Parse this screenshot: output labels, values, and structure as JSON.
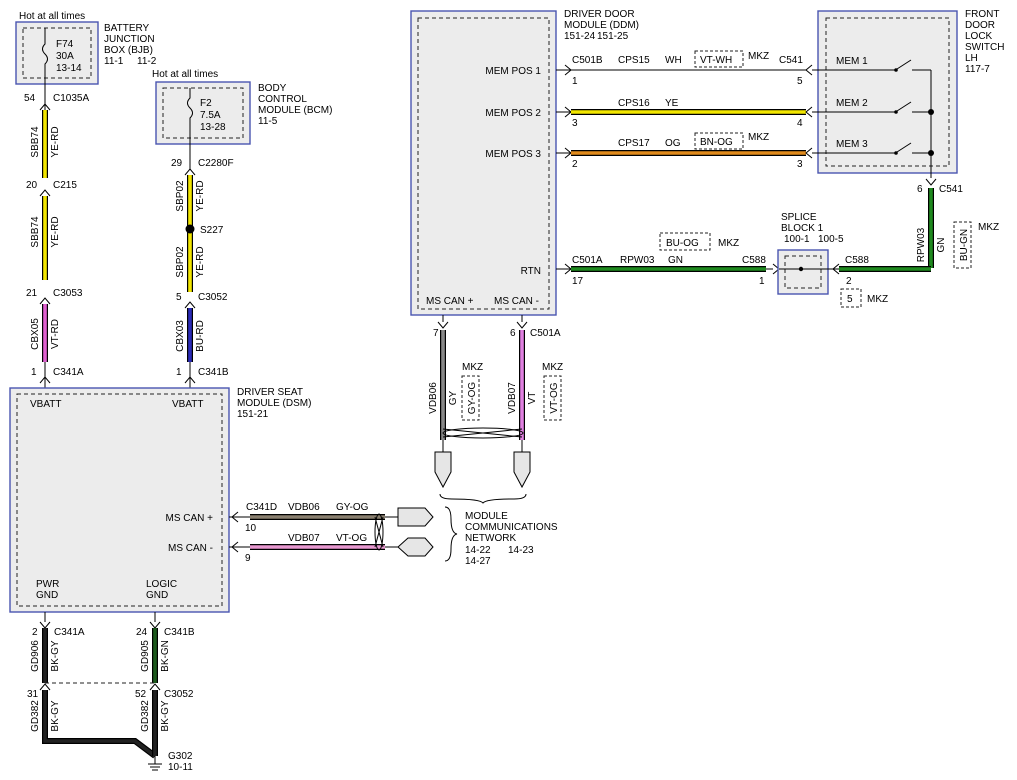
{
  "colors": {
    "module_border": "#4a55b0",
    "module_fill": "#ececec",
    "YE-RD": "#f2e600",
    "VT-RD": "#e060d0",
    "BU-RD": "#2a2ab8",
    "BK-GY": "#222222",
    "BK-GN": "#1d5a1d",
    "GY-OG": "#8a8070",
    "VT-OG": "#e898d0",
    "GY": "#888888",
    "VT": "#e080e0",
    "WH": "#ffffff",
    "YE": "#f2e600",
    "OG": "#e08a1c",
    "GN": "#1f8a1f"
  },
  "bjb": {
    "hot": "Hot at all times",
    "fuse": "F74",
    "amps": "30A",
    "pins": "13-14",
    "title1": "BATTERY",
    "title2": "JUNCTION",
    "title3": "BOX (BJB)",
    "ref_a": "11-1",
    "ref_b": "11-2"
  },
  "bcm": {
    "hot": "Hot at all times",
    "fuse": "F2",
    "amps": "7.5A",
    "pins": "13-28",
    "title1": "BODY",
    "title2": "CONTROL",
    "title3": "MODULE (BCM)",
    "ref": "11-5"
  },
  "wire_left": {
    "pin54": "54",
    "c1035a": "C1035A",
    "circ1": "SBB74",
    "col1": "YE-RD",
    "pin20": "20",
    "c215": "C215",
    "circ2": "SBB74",
    "col2": "YE-RD",
    "pin21": "21",
    "c3053": "C3053",
    "circ3": "CBX05",
    "col3": "VT-RD",
    "pin1": "1",
    "c341a": "C341A"
  },
  "wire_mid": {
    "pin29": "29",
    "c2280f": "C2280F",
    "circ1": "SBP02",
    "col1": "YE-RD",
    "splice": "S227",
    "circ2": "SBP02",
    "col2": "YE-RD",
    "pin5": "5",
    "c3052": "C3052",
    "circ3": "CBX03",
    "col3": "BU-RD",
    "pin1": "1",
    "c341b": "C341B"
  },
  "dsm": {
    "vbatt_a": "VBATT",
    "vbatt_b": "VBATT",
    "title1": "DRIVER SEAT",
    "title2": "MODULE (DSM)",
    "ref": "151-21",
    "mscan_plus": "MS CAN +",
    "mscan_minus": "MS CAN -",
    "pwr1": "PWR",
    "pwr2": "GND",
    "logic1": "LOGIC",
    "logic2": "GND"
  },
  "dsm_can": {
    "conn": "C341D",
    "circ1": "VDB06",
    "col1": "GY-OG",
    "pin1": "10",
    "circ2": "VDB07",
    "col2": "VT-OG",
    "pin2": "9"
  },
  "network": {
    "l1": "MODULE",
    "l2": "COMMUNICATIONS",
    "l3": "NETWORK",
    "r1": "14-22",
    "r2": "14-23",
    "r3": "14-27"
  },
  "grounds": {
    "pin2": "2",
    "c341a": "C341A",
    "circ_a": "GD906",
    "col_a": "BK-GY",
    "pin24": "24",
    "c341b": "C341B",
    "circ_b": "GD905",
    "col_b": "BK-GN",
    "pin31": "31",
    "pin52": "52",
    "c3052": "C3052",
    "circ_c": "GD382",
    "col_c": "BK-GY",
    "circ_d": "GD382",
    "col_d": "BK-GY",
    "ground": "G302",
    "ground_ref": "10-11"
  },
  "ddm": {
    "title1": "DRIVER DOOR",
    "title2": "MODULE (DDM)",
    "ref_a": "151-24",
    "ref_b": "151-25",
    "mem1": "MEM POS 1",
    "mem2": "MEM POS 2",
    "mem3": "MEM POS 3",
    "rtn": "RTN",
    "mscan_plus": "MS CAN +",
    "mscan_minus": "MS CAN -"
  },
  "ddm_wires": {
    "c501b": "C501B",
    "p1": "1",
    "circ1": "CPS15",
    "col1": "WH",
    "opt1": "VT-WH",
    "mkz1": "MKZ",
    "c541": "C541",
    "q1": "5",
    "p2": "3",
    "circ2": "CPS16",
    "col2": "YE",
    "q2": "4",
    "p3": "2",
    "circ3": "CPS17",
    "col3": "OG",
    "opt3": "BN-OG",
    "mkz3": "MKZ",
    "q3": "3"
  },
  "rtn_wire": {
    "c501a": "C501A",
    "pin17": "17",
    "circ": "RPW03",
    "col": "GN",
    "c588a": "C588",
    "pin1": "1",
    "opt": "BU-OG",
    "mkz": "MKZ",
    "c588b": "C588",
    "pin2": "2",
    "alt_pin": "5",
    "alt_mkz": "MKZ"
  },
  "splice_block": {
    "l1": "SPLICE",
    "l2": "BLOCK 1",
    "ref_a": "100-1",
    "ref_b": "100-5"
  },
  "switch": {
    "title1": "FRONT",
    "title2": "DOOR",
    "title3": "LOCK",
    "title4": "SWITCH",
    "title5": "LH",
    "ref": "117-7",
    "mem1": "MEM 1",
    "mem2": "MEM 2",
    "mem3": "MEM 3",
    "pin6": "6",
    "c541": "C541",
    "circ": "RPW03",
    "col": "GN",
    "opt": "BU-GN",
    "mkz": "MKZ"
  },
  "ddm_can": {
    "pin7": "7",
    "pin6": "6",
    "c501a": "C501A",
    "circ1": "VDB06",
    "col1": "GY",
    "opt1": "GY-OG",
    "mkz1": "MKZ",
    "circ2": "VDB07",
    "col2": "VT",
    "opt2": "VT-OG",
    "mkz2": "MKZ"
  }
}
